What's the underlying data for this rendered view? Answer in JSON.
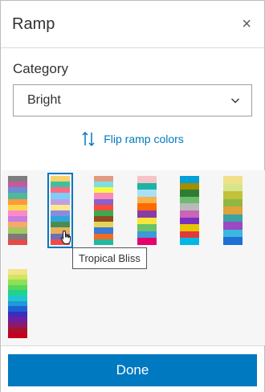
{
  "dialog": {
    "title": "Ramp",
    "close_glyph": "×"
  },
  "category": {
    "label": "Category",
    "selected": "Bright"
  },
  "flip": {
    "label": "Flip ramp colors",
    "icon": "swap-vertical-icon"
  },
  "tooltip": {
    "text": "Tropical Bliss"
  },
  "footer": {
    "done_label": "Done"
  },
  "colors": {
    "accent": "#0079c1"
  },
  "ramps": [
    {
      "selected": false,
      "colors": [
        "#7d7d7d",
        "#c45a9e",
        "#6a8dd3",
        "#50b89a",
        "#ff9a3c",
        "#f7d94b",
        "#fd8ac8",
        "#c87ce0",
        "#f7a86b",
        "#a4c95e",
        "#7a7a7a",
        "#e34b4b"
      ]
    },
    {
      "selected": true,
      "colors": [
        "#f7d26b",
        "#3fbf9f",
        "#fd6a83",
        "#7dcdf8",
        "#bda0e3",
        "#ffe98a",
        "#8a8ae0",
        "#2fa6d6",
        "#4a8b54",
        "#e5b25b",
        "#6d6db8",
        "#ee4b4b"
      ]
    },
    {
      "selected": false,
      "colors": [
        "#e39a82",
        "#7be0e0",
        "#f7f742",
        "#fb8ab8",
        "#8a60c9",
        "#ff4a3a",
        "#3ea852",
        "#8e4b1f",
        "#e9d45b",
        "#3a7bd5",
        "#f56a23",
        "#26b7a0"
      ]
    },
    {
      "selected": false,
      "colors": [
        "#f5c3c8",
        "#1cb3a5",
        "#a9e0f7",
        "#f7b24a",
        "#ff6a00",
        "#8a3ca5",
        "#f7e53b",
        "#6ac26a",
        "#3a9bd8",
        "#e6006b"
      ]
    },
    {
      "selected": false,
      "colors": [
        "#009fd8",
        "#a38d00",
        "#2e7d32",
        "#6dbb6d",
        "#b9b9b9",
        "#c964b8",
        "#7b2fbd",
        "#e6c600",
        "#e03a3a",
        "#00b8e6"
      ]
    },
    {
      "selected": false,
      "colors": [
        "#f0e08a",
        "#d9e58a",
        "#c2c23a",
        "#8fb842",
        "#e0a23a",
        "#3aa3a3",
        "#9a4ac2",
        "#3ab8e0",
        "#1f6fd5"
      ]
    },
    {
      "selected": false,
      "colors": [
        "#f2e38c",
        "#d4e55c",
        "#8ee057",
        "#56d65a",
        "#1fd28f",
        "#1fc4d1",
        "#1f9ad6",
        "#1f5fd6",
        "#3a2fb8",
        "#6a1ea8",
        "#8c1a6a",
        "#a8102e",
        "#c4001e"
      ]
    }
  ]
}
